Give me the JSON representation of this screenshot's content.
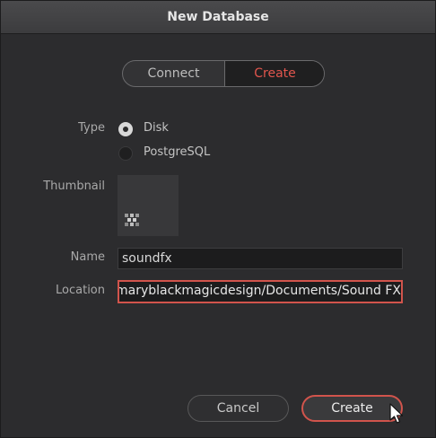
{
  "dialog": {
    "title": "New Database"
  },
  "segmented": {
    "options": [
      "Connect",
      "Create"
    ],
    "selected": "Create"
  },
  "type": {
    "label": "Type",
    "options": [
      {
        "label": "Disk",
        "selected": true
      },
      {
        "label": "PostgreSQL",
        "selected": false
      }
    ]
  },
  "thumbnail": {
    "label": "Thumbnail"
  },
  "name": {
    "label": "Name",
    "value": "soundfx"
  },
  "location": {
    "label": "Location",
    "value": "ers/maryblackmagicdesign/Documents/Sound FX"
  },
  "buttons": {
    "cancel": "Cancel",
    "create": "Create"
  },
  "colors": {
    "accent": "#d1544c",
    "background": "#2c2c2e"
  },
  "icons": [
    "database-thumbnail-icon",
    "mouse-pointer-icon"
  ]
}
